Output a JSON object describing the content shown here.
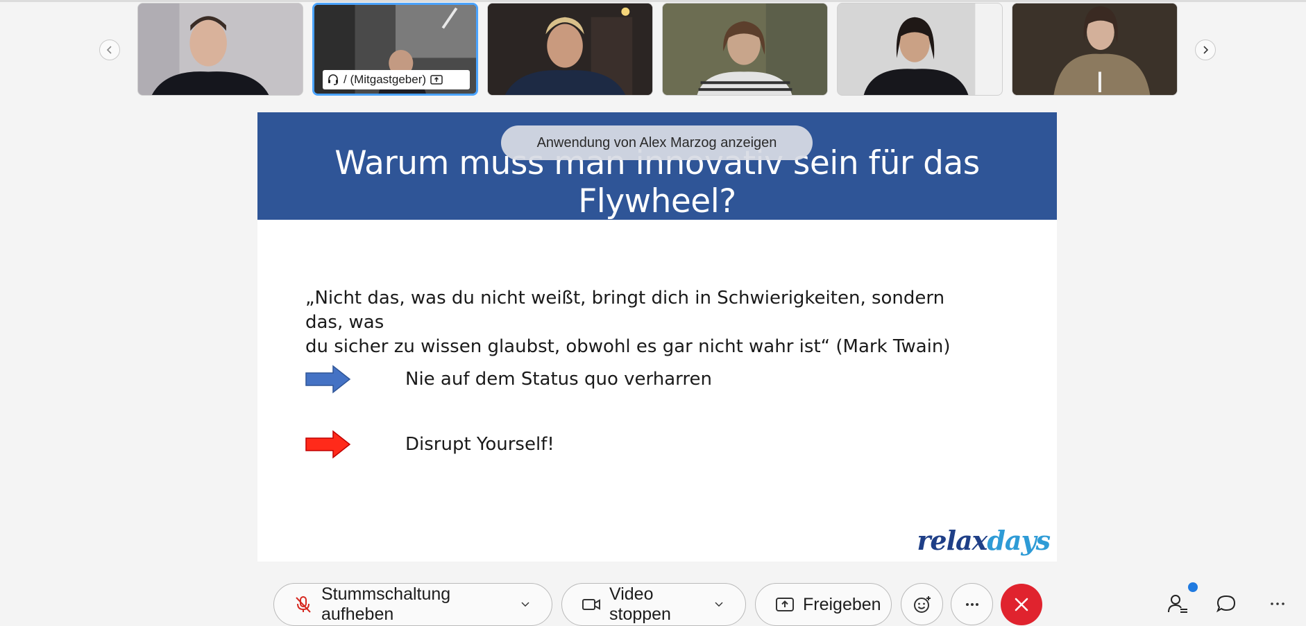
{
  "filmstrip": {
    "participants": [
      {
        "id": "participant-1"
      },
      {
        "id": "participant-2",
        "name_tag": "/ (Mitgastgeber)"
      },
      {
        "id": "participant-3"
      },
      {
        "id": "participant-4"
      },
      {
        "id": "participant-5"
      },
      {
        "id": "participant-6"
      }
    ]
  },
  "share_banner": {
    "text": "Anwendung von Alex Marzog anzeigen"
  },
  "slide": {
    "title": "Warum muss man innovativ sein für das Flywheel?",
    "quote_line1": "„Nicht das, was du nicht weißt, bringt dich in Schwierigkeiten, sondern das, was",
    "quote_line2": "du sicher zu wissen glaubst, obwohl es gar nicht wahr ist“ (Mark Twain)",
    "bullets": [
      {
        "text": "Nie auf dem Status quo verharren",
        "arrow_color": "#4472c4"
      },
      {
        "text": "Disrupt Yourself!",
        "arrow_color": "#ff2a1a"
      }
    ],
    "logo": {
      "part1": "relax",
      "part2": "x",
      "part3": "days"
    }
  },
  "toolbar": {
    "unmute_label": "Stummschaltung aufheben",
    "video_label": "Video stoppen",
    "share_label": "Freigeben"
  },
  "colors": {
    "slide_header": "#2f5597",
    "end_call": "#e0232e",
    "accent": "#4aa3ff"
  }
}
